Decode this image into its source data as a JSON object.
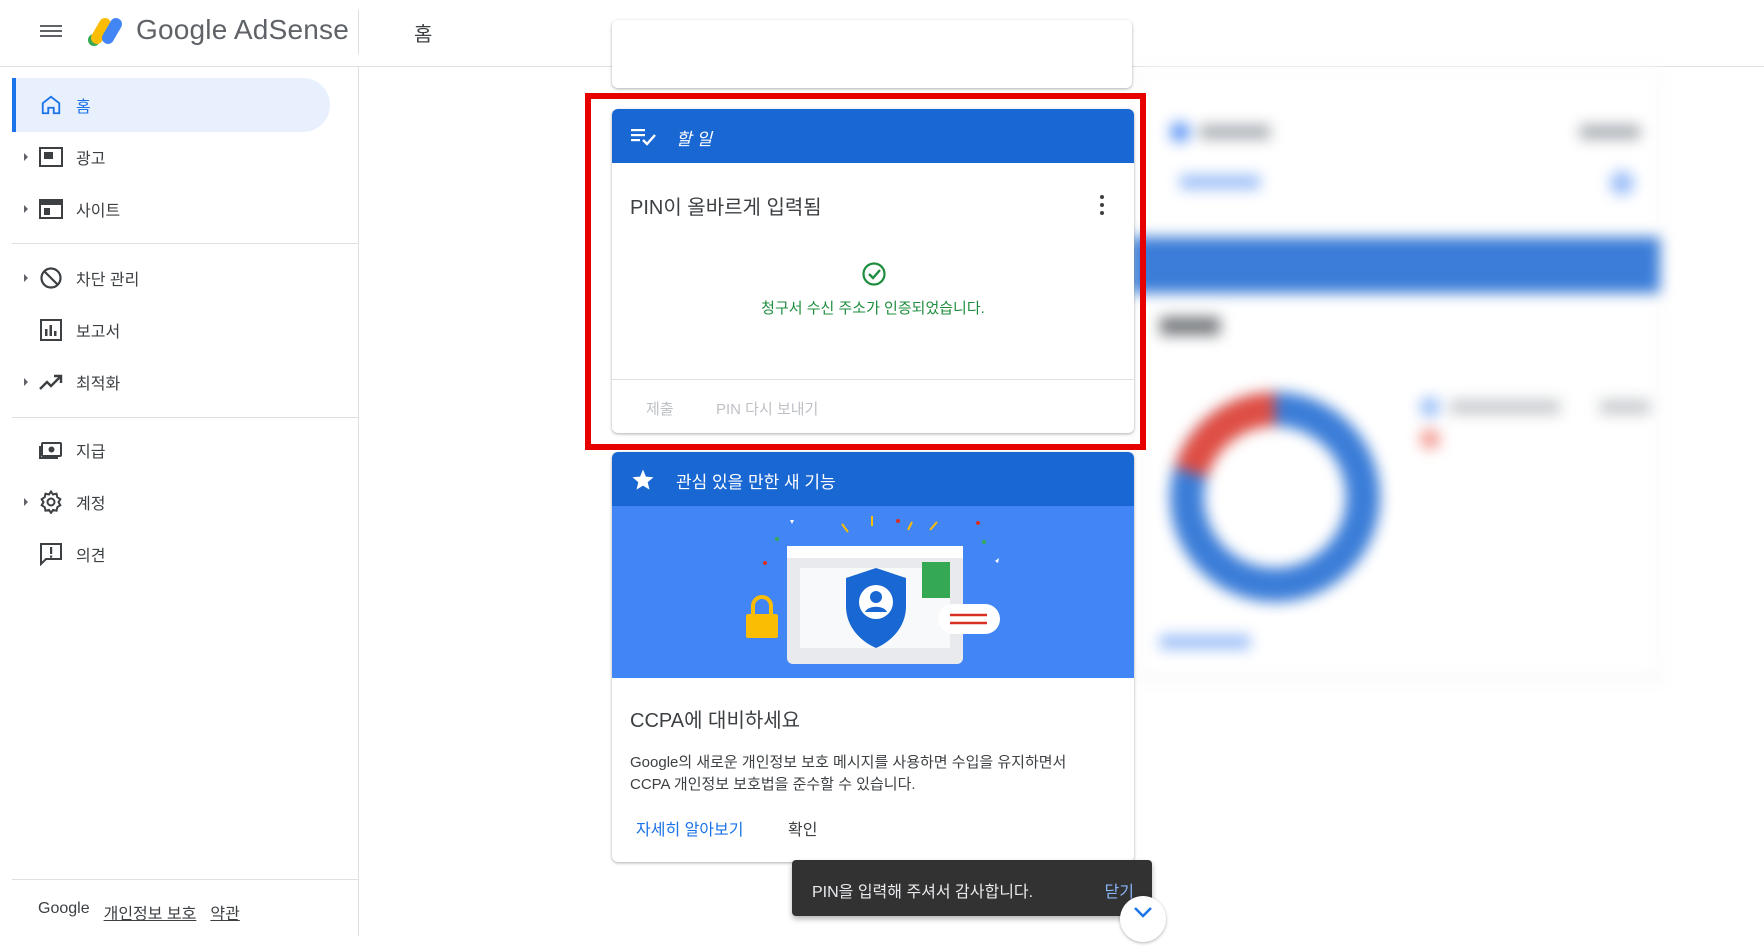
{
  "header": {
    "brand": "Google AdSense",
    "page_title": "홈"
  },
  "sidebar": {
    "items": [
      {
        "label": "홈",
        "icon": "home-icon",
        "active": true
      },
      {
        "label": "광고",
        "icon": "ads-icon",
        "expandable": true
      },
      {
        "label": "사이트",
        "icon": "sites-icon",
        "expandable": true
      },
      {
        "label": "차단 관리",
        "icon": "block-icon",
        "expandable": true
      },
      {
        "label": "보고서",
        "icon": "reports-icon"
      },
      {
        "label": "최적화",
        "icon": "optimize-icon",
        "expandable": true
      },
      {
        "label": "지급",
        "icon": "payments-icon"
      },
      {
        "label": "계정",
        "icon": "gear-icon",
        "expandable": true
      },
      {
        "label": "의견",
        "icon": "feedback-icon"
      }
    ],
    "footer": {
      "google": "Google",
      "privacy": "개인정보 보호",
      "terms": "약관"
    }
  },
  "todo_card": {
    "header": "할 일",
    "title": "PIN이 올바르게 입력됨",
    "success_message": "청구서 수신 주소가 인증되었습니다.",
    "submit_label": "제출",
    "resend_label": "PIN 다시 보내기"
  },
  "feature_card": {
    "header": "관심 있을 만한 새 기능",
    "title": "CCPA에 대비하세요",
    "description": "Google의 새로운 개인정보 보호 메시지를 사용하면 수입을 유지하면서 CCPA 개인정보 보호법을 준수할 수 있습니다.",
    "learn_more_label": "자세히 알아보기",
    "confirm_label": "확인"
  },
  "snackbar": {
    "message": "PIN을 입력해 주셔서 감사합니다.",
    "close_label": "닫기"
  },
  "colors": {
    "primary": "#1967d2",
    "link": "#1a73e8",
    "success": "#1e8e3e",
    "highlight": "#e60000"
  }
}
